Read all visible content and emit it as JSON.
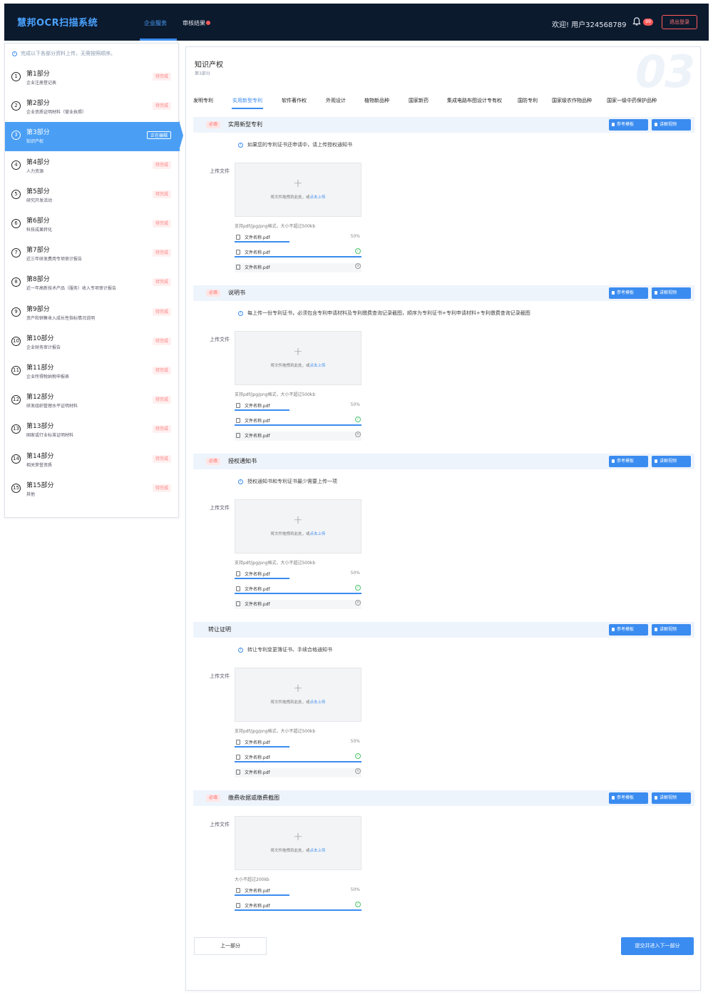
{
  "header": {
    "logo": "慧邦OCR扫描系统",
    "nav": [
      {
        "label": "企业服务"
      },
      {
        "label": "审核结果"
      }
    ],
    "welcome": "欢迎!  用户324568789",
    "notif_count": "99",
    "logout": "退出登录"
  },
  "sidebar": {
    "tip": "完成以下各部分资料上传，无需按照顺序。",
    "items": [
      {
        "num": "1",
        "title": "第1部分",
        "sub": "企业注册登记表",
        "status": "待完成"
      },
      {
        "num": "2",
        "title": "第2部分",
        "sub": "企业资质证明材料（营业执照）",
        "status": "待完成"
      },
      {
        "num": "3",
        "title": "第3部分",
        "sub": "知识产权",
        "status": "正在编辑"
      },
      {
        "num": "4",
        "title": "第4部分",
        "sub": "人力资源",
        "status": "待完成"
      },
      {
        "num": "5",
        "title": "第5部分",
        "sub": "研究开发活动",
        "status": "待完成"
      },
      {
        "num": "6",
        "title": "第6部分",
        "sub": "科技成果转化",
        "status": "待完成"
      },
      {
        "num": "7",
        "title": "第7部分",
        "sub": "近三年研发费用专项审计报告",
        "status": "待完成"
      },
      {
        "num": "8",
        "title": "第8部分",
        "sub": "近一年高新技术产品（服务）收入专项审计报告",
        "status": "待完成"
      },
      {
        "num": "9",
        "title": "第9部分",
        "sub": "资产和销售收入成长性指标情况说明",
        "status": "待完成"
      },
      {
        "num": "10",
        "title": "第10部分",
        "sub": "企业财务审计报告",
        "status": "待完成"
      },
      {
        "num": "11",
        "title": "第11部分",
        "sub": "企业所得税纳税申报表",
        "status": "待完成"
      },
      {
        "num": "12",
        "title": "第12部分",
        "sub": "研发组织管理水平证明材料",
        "status": "待完成"
      },
      {
        "num": "13",
        "title": "第13部分",
        "sub": "国家或行业标准证明材料",
        "status": "待完成"
      },
      {
        "num": "14",
        "title": "第14部分",
        "sub": "相关荣誉资质",
        "status": "待完成"
      },
      {
        "num": "15",
        "title": "第15部分",
        "sub": "其他",
        "status": "待完成"
      }
    ]
  },
  "main": {
    "title": "知识产权",
    "subtitle": "第3部分",
    "big_number": "03",
    "tabs": [
      "发明专利",
      "实用新型专利",
      "软件著作权",
      "外观设计",
      "植物新品种",
      "国家新药",
      "集成电路布图设计专有权",
      "国防专利",
      "国家级农作物品种",
      "国家一级中药保护品种"
    ],
    "required_label": "必填",
    "btn_template": "参考模板",
    "btn_video": "讲解视频",
    "upload_label": "上传文件",
    "drop_text": "将文件拖拽到此处，或",
    "drop_link": "点击上传",
    "file_name": "文件名称.pdf",
    "file_percent": "50%",
    "sections": [
      {
        "title": "实用新型专利",
        "required": true,
        "hint": "如果您的专利证书还申请中，请上传授权通知书",
        "format": "支持pdf/jpg/png格式，大小不超过500kb"
      },
      {
        "title": "说明书",
        "required": true,
        "hint": "每上传一份专利证书，必须包含专利申请材料及专利缴费查询记录截图，顺序为专利证书+专利申请材料+专利缴费查询记录截图",
        "format": "支持pdf/jpg/png格式，大小不超过500kb"
      },
      {
        "title": "授权通知书",
        "required": true,
        "hint": "授权通知书和专利证书最少需要上传一项",
        "format": "支持pdf/jpg/png格式，大小不超过500kb"
      },
      {
        "title": "转让证明",
        "required": false,
        "hint": "转让专利变更簿证书、手续合格通知书",
        "format": "支持pdf/jpg/png格式，大小不超过500kb"
      },
      {
        "title": "缴费收据或缴费截图",
        "required": true,
        "hint": "",
        "format": "大小不超过200kb"
      }
    ],
    "btn_prev": "上一部分",
    "btn_next": "提交并进入下一部分"
  },
  "colors": {
    "header_bg": "#0c1a2e",
    "accent": "#3b8cf0",
    "active_item": "#4a9ff5",
    "pending": "#ff7b7b",
    "success": "#4cc46b"
  }
}
